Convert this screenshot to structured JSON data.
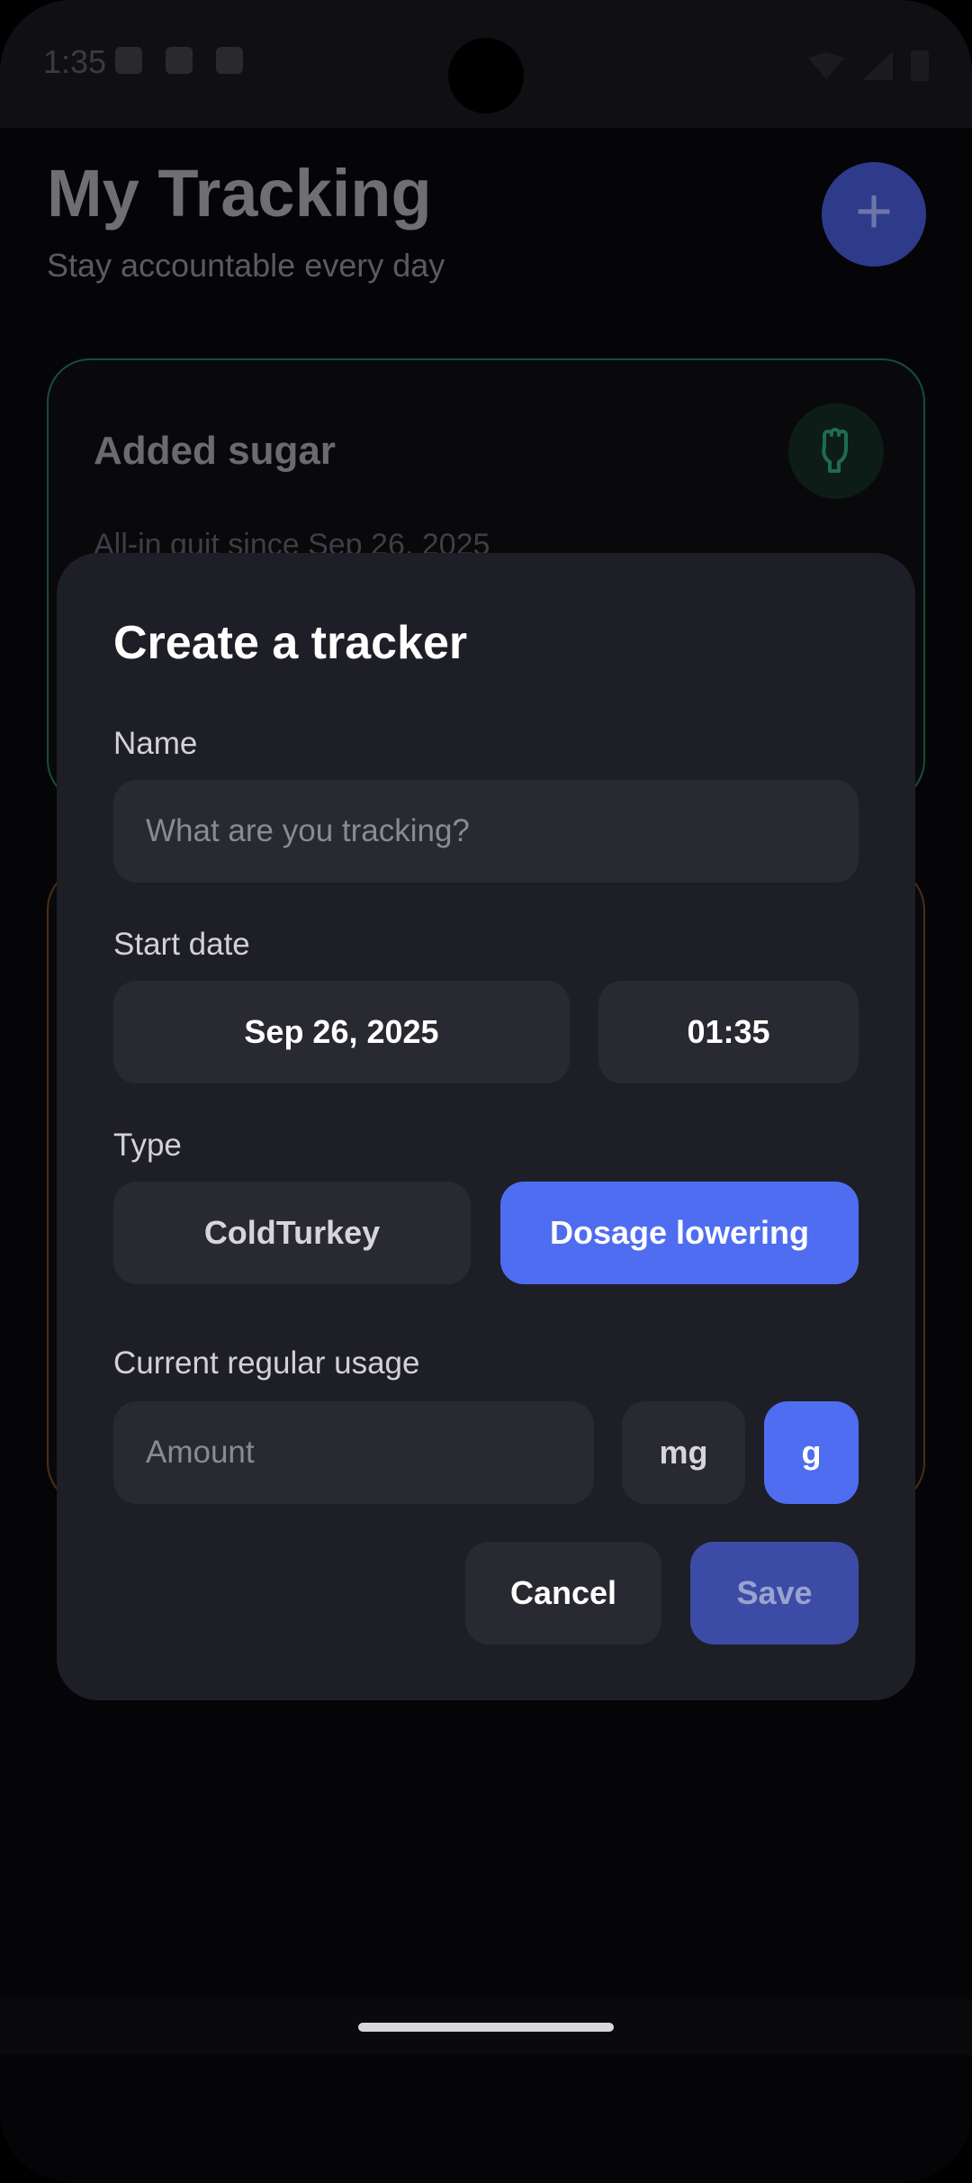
{
  "status_bar": {
    "time": "1:35"
  },
  "background": {
    "title": "My Tracking",
    "subtitle": "Stay accountable every day",
    "fab_label": "+",
    "card": {
      "title": "Added sugar",
      "subtitle": "All-in quit since Sep 26, 2025"
    }
  },
  "dialog": {
    "title": "Create a tracker",
    "name_label": "Name",
    "name_placeholder": "What are you tracking?",
    "start_date_label": "Start date",
    "date_value": "Sep 26, 2025",
    "time_value": "01:35",
    "type_label": "Type",
    "type_options": [
      "ColdTurkey",
      "Dosage lowering"
    ],
    "selected_type": "Dosage lowering",
    "usage_label": "Current regular usage",
    "amount_placeholder": "Amount",
    "units": [
      "mg",
      "g"
    ],
    "selected_unit": "g",
    "cancel_label": "Cancel",
    "save_label": "Save"
  },
  "colors": {
    "accent": "#4f6df0",
    "dialog_bg": "#1e1e26",
    "field_bg": "#292932",
    "save_disabled": "#3c4ca6"
  }
}
